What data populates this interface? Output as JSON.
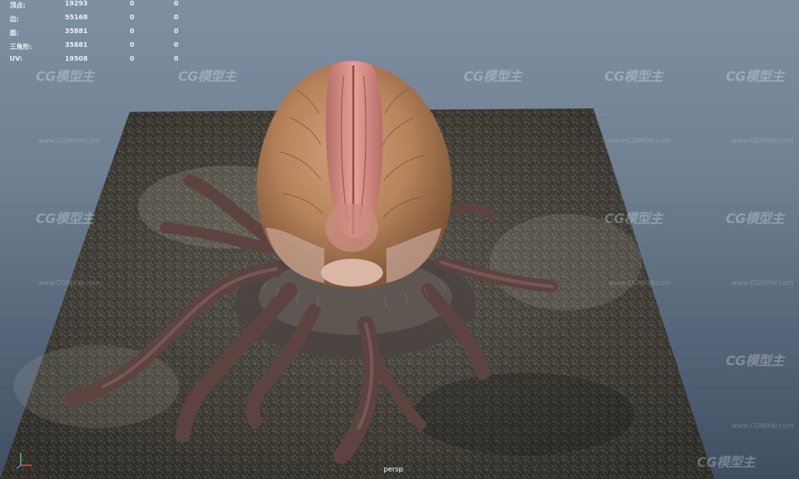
{
  "hud": {
    "rows": [
      {
        "label": "顶点:",
        "v1": "19293",
        "v2": "0",
        "v3": "0"
      },
      {
        "label": "边:",
        "v1": "55168",
        "v2": "0",
        "v3": "0"
      },
      {
        "label": "面:",
        "v1": "35881",
        "v2": "0",
        "v3": "0"
      },
      {
        "label": "三角形:",
        "v1": "35881",
        "v2": "0",
        "v3": "0"
      },
      {
        "label": "UV:",
        "v1": "19508",
        "v2": "0",
        "v3": "0"
      }
    ]
  },
  "camera": {
    "label": "persp"
  },
  "watermark": {
    "logo": "CG模型主",
    "url": "www.CGMXW.com"
  },
  "colors": {
    "sky_top": "#7e8fa1",
    "sky_bottom": "#404e60",
    "ground": "#3e3c33",
    "pod": "#b7835b",
    "pod_seam": "#d88a84",
    "roots": "#5c4340"
  },
  "icons": {
    "axis": "axis-gizmo-icon"
  }
}
